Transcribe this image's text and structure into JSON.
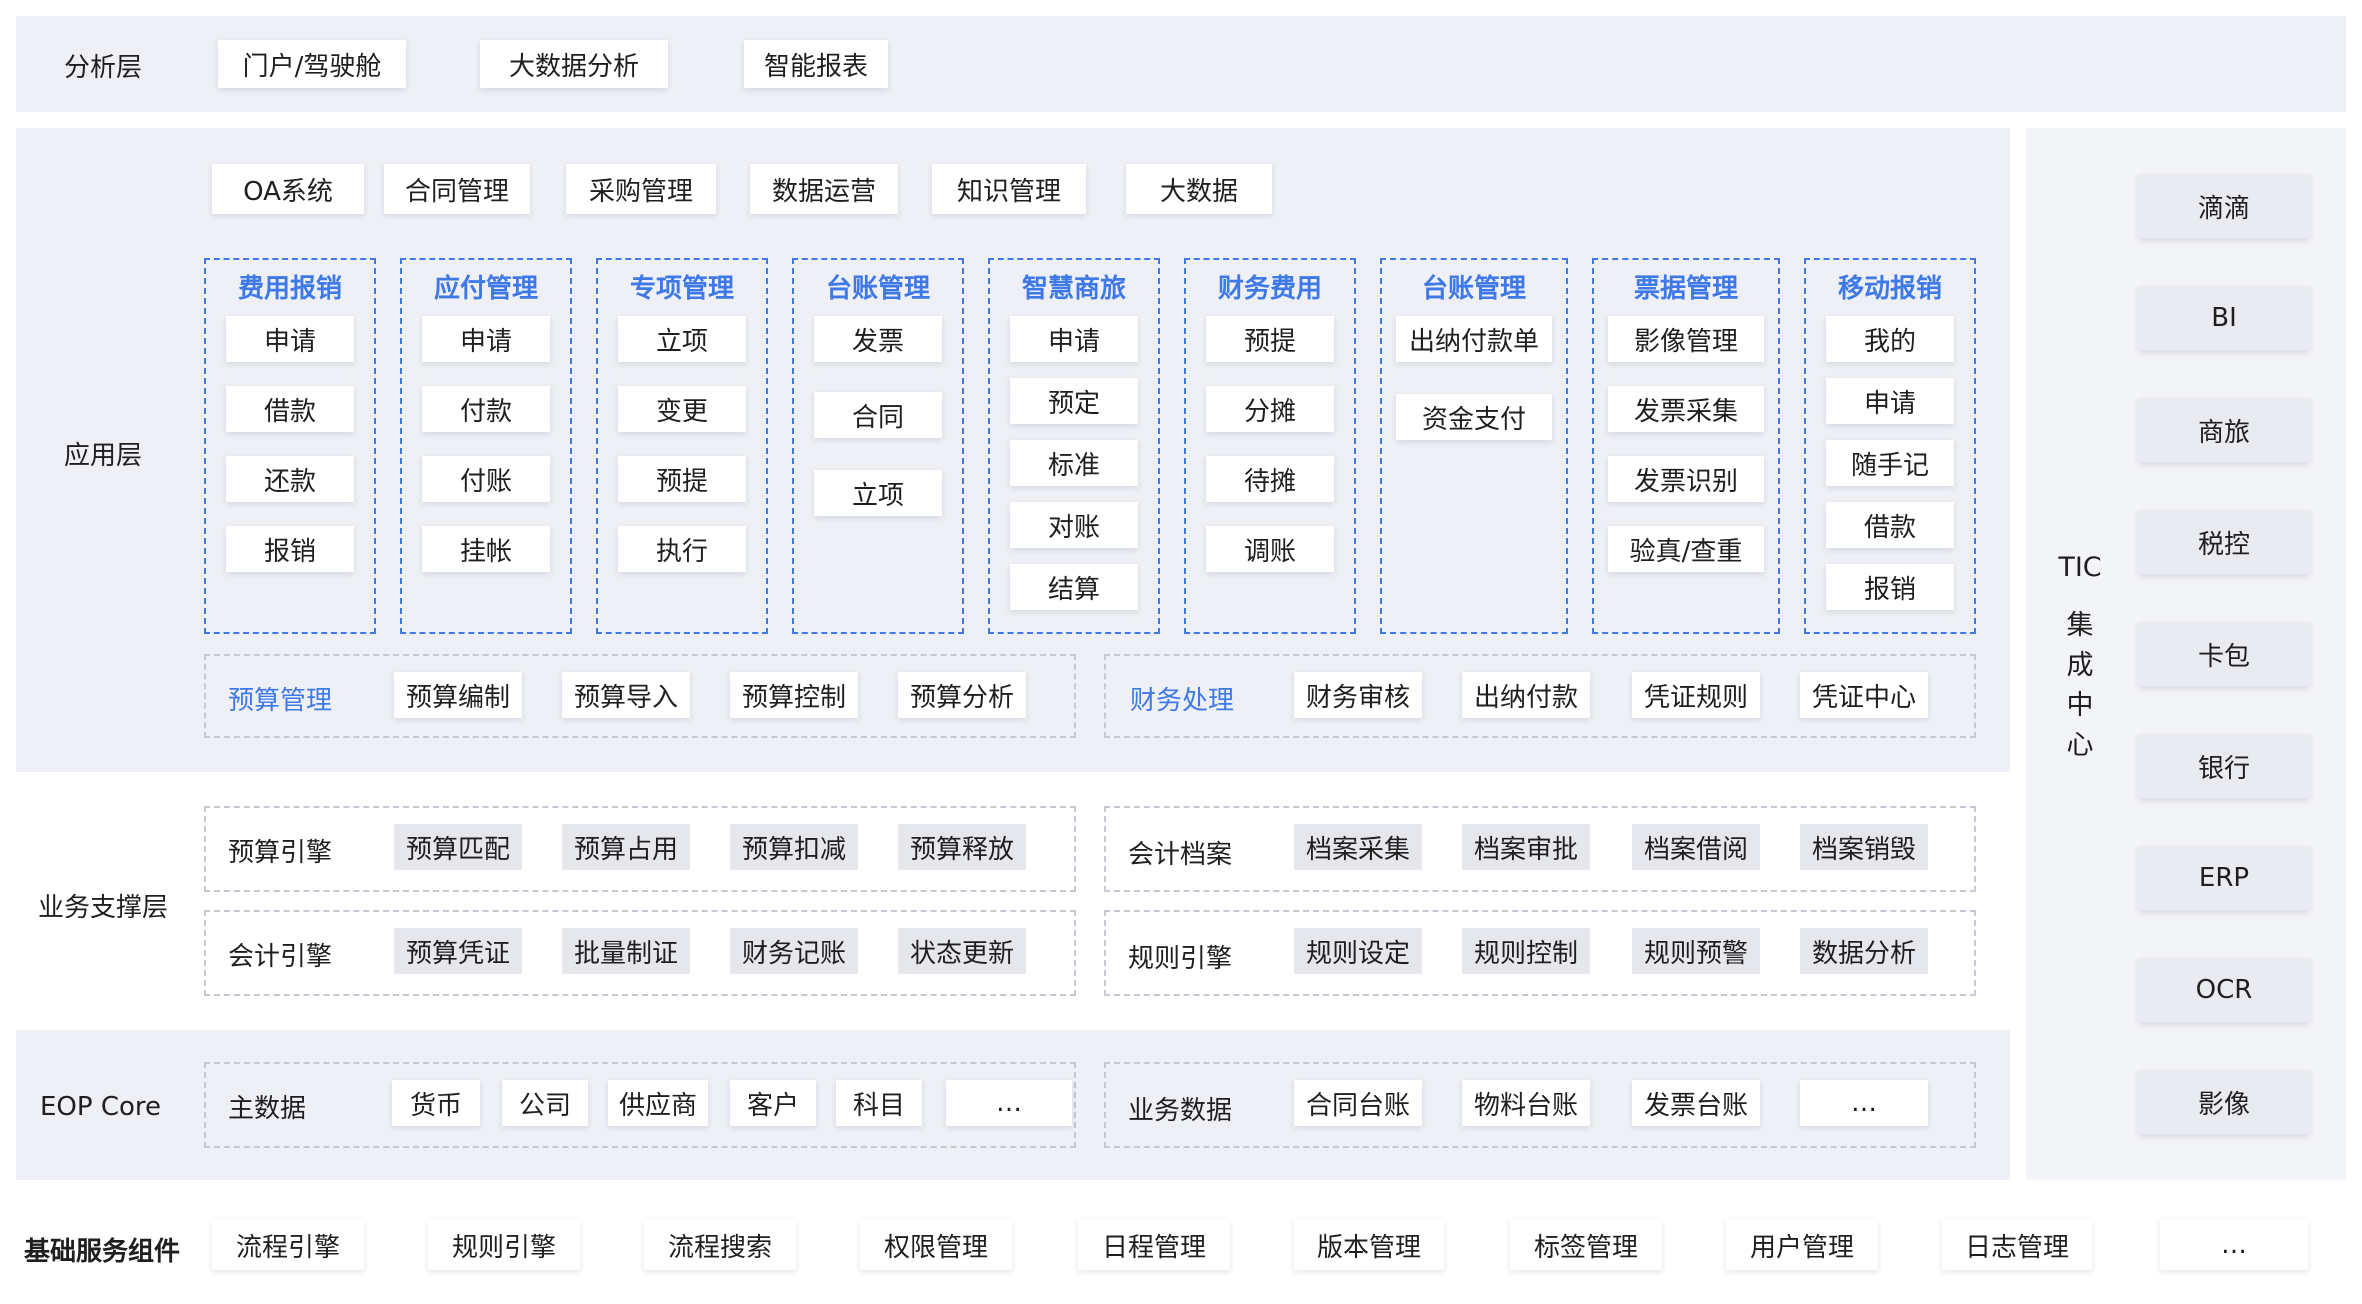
{
  "analysis_layer": {
    "label": "分析层",
    "items": [
      "门户/驾驶舱",
      "大数据分析",
      "智能报表"
    ]
  },
  "application_layer": {
    "label": "应用层",
    "systems": [
      "OA系统",
      "合同管理",
      "采购管理",
      "数据运营",
      "知识管理",
      "大数据"
    ],
    "modules": [
      {
        "title": "费用报销",
        "items": [
          "申请",
          "借款",
          "还款",
          "报销"
        ]
      },
      {
        "title": "应付管理",
        "items": [
          "申请",
          "付款",
          "付账",
          "挂帐"
        ]
      },
      {
        "title": "专项管理",
        "items": [
          "立项",
          "变更",
          "预提",
          "执行"
        ]
      },
      {
        "title": "台账管理",
        "items": [
          "发票",
          "合同",
          "立项"
        ]
      },
      {
        "title": "智慧商旅",
        "items": [
          "申请",
          "预定",
          "标准",
          "对账",
          "结算"
        ]
      },
      {
        "title": "财务费用",
        "items": [
          "预提",
          "分摊",
          "待摊",
          "调账"
        ]
      },
      {
        "title": "台账管理",
        "items": [
          "出纳付款单",
          "资金支付"
        ]
      },
      {
        "title": "票据管理",
        "items": [
          "影像管理",
          "发票采集",
          "发票识别",
          "验真/查重"
        ]
      },
      {
        "title": "移动报销",
        "items": [
          "我的",
          "申请",
          "随手记",
          "借款",
          "报销"
        ]
      }
    ],
    "budget": {
      "title": "预算管理",
      "items": [
        "预算编制",
        "预算导入",
        "预算控制",
        "预算分析"
      ]
    },
    "finance": {
      "title": "财务处理",
      "items": [
        "财务审核",
        "出纳付款",
        "凭证规则",
        "凭证中心"
      ]
    }
  },
  "business_support_layer": {
    "label": "业务支撑层",
    "rows": [
      {
        "title": "预算引擎",
        "items": [
          "预算匹配",
          "预算占用",
          "预算扣减",
          "预算释放"
        ]
      },
      {
        "title": "会计档案",
        "items": [
          "档案采集",
          "档案审批",
          "档案借阅",
          "档案销毁"
        ]
      },
      {
        "title": "会计引擎",
        "items": [
          "预算凭证",
          "批量制证",
          "财务记账",
          "状态更新"
        ]
      },
      {
        "title": "规则引擎",
        "items": [
          "规则设定",
          "规则控制",
          "规则预警",
          "数据分析"
        ]
      }
    ]
  },
  "eop_core": {
    "label": "EOP Core",
    "master_data": {
      "title": "主数据",
      "items": [
        "货币",
        "公司",
        "供应商",
        "客户",
        "科目",
        "…"
      ]
    },
    "business_data": {
      "title": "业务数据",
      "items": [
        "合同台账",
        "物料台账",
        "发票台账",
        "…"
      ]
    }
  },
  "tic": {
    "title_lines": [
      "TIC",
      "集",
      "成",
      "中",
      "心"
    ],
    "items": [
      "滴滴",
      "BI",
      "商旅",
      "税控",
      "卡包",
      "银行",
      "ERP",
      "OCR",
      "影像"
    ]
  },
  "base_services": {
    "label": "基础服务组件",
    "items": [
      "流程引擎",
      "规则引擎",
      "流程搜索",
      "权限管理",
      "日程管理",
      "版本管理",
      "标签管理",
      "用户管理",
      "日志管理",
      "…"
    ]
  }
}
